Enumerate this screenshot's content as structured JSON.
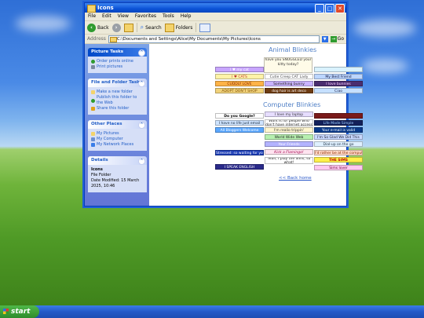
{
  "window": {
    "title": "Icons"
  },
  "menu": [
    "File",
    "Edit",
    "View",
    "Favorites",
    "Tools",
    "Help"
  ],
  "toolbar": {
    "back": "Back",
    "search": "Search",
    "folders": "Folders"
  },
  "address": {
    "label": "Address",
    "value": "C:\\Documents and Settings\\Alice\\My Documents\\My Pictures\\Icons",
    "go": "Go"
  },
  "sidepane": {
    "picture_tasks": {
      "title": "Picture Tasks",
      "items": [
        "Order prints online",
        "Print pictures"
      ]
    },
    "file_tasks": {
      "title": "File and Folder Tasks",
      "items": [
        "Make a new folder",
        "Publish this folder to the Web",
        "Share this folder"
      ]
    },
    "other_places": {
      "title": "Other Places",
      "items": [
        "My Pictures",
        "My Computer",
        "My Network Places"
      ]
    },
    "details": {
      "title": "Details",
      "name": "Icons",
      "type": "File Folder",
      "modified": "Date Modified: 15 March 2025, 10:46"
    }
  },
  "main": {
    "animal_heading": "Animal Blinkies",
    "computer_heading": "Computer Blinkies",
    "back_link": "<< Back home",
    "animal_blinkies": [
      "I ♥ my cat",
      "have you SNUGGLED your kitty today?",
      "I ♥ CATS",
      "Cutie Creep CAT Lady",
      "My Best Friend",
      "CUDDLY LOVE",
      "Something bunny",
      "I love bunnies",
      "ADOPT DON'T SHOP",
      "dog hair is art deco",
      "Ciao"
    ],
    "computer_blinkies": [
      "Do you Google?",
      "I love my laptop",
      "I have no life just email",
      "Work is for people who don't have internet access",
      "Life Made Simple",
      "All Bloggers Welcome",
      "I'm realio trippin'",
      "Your e-mail is valid",
      "World Wide Web",
      "I'm so cool",
      "I'm So Glad We Did This",
      "Your Friends",
      "Dial-up on the go",
      "Kick a Flamingo!",
      "Stressed: so waiting for you",
      "I'd rather be at the computer",
      "Yeah, I play the Sims, so what!",
      "THE SIMS",
      "I SPEAK ENGLISH",
      "Sims lover"
    ]
  },
  "taskbar": {
    "start": "start"
  }
}
